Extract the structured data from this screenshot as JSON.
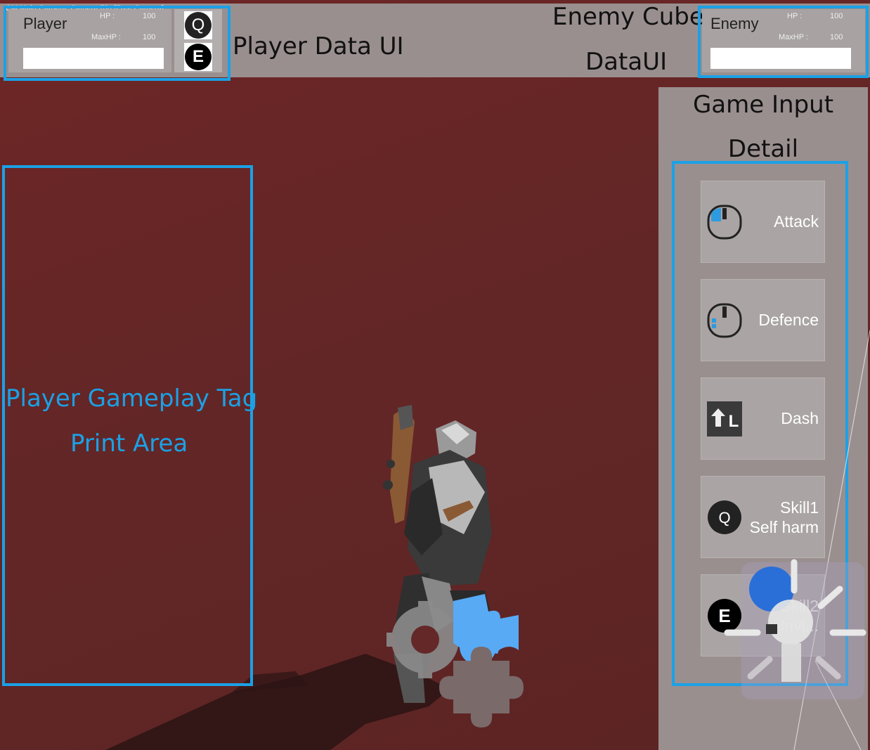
{
  "camera_caption": "CM Main Camera: Camera Rig [Free Camera]",
  "player_panel": {
    "name": "Player",
    "hp_label": "HP :",
    "hp_value": "100",
    "maxhp_label": "MaxHP :",
    "maxhp_value": "100"
  },
  "enemy_panel": {
    "name": "Enemy",
    "hp_label": "HP :",
    "hp_value": "100",
    "maxhp_label": "MaxHP :",
    "maxhp_value": "100"
  },
  "skill_icons": {
    "q_key": "Q",
    "e_key": "E"
  },
  "annotations": {
    "player_data_ui": "Player Data UI",
    "enemy_line1": "Enemy Cube",
    "enemy_line2": "DataUI",
    "game_input_line1": "Game Input",
    "game_input_line2": "Detail",
    "gameplay_tag_line1": "Player Gameplay Tag",
    "gameplay_tag_line2": "Print Area"
  },
  "input_cards": [
    {
      "label": "Attack",
      "icon": "mouse-left-click-icon"
    },
    {
      "label": "Defence",
      "icon": "mouse-right-click-icon"
    },
    {
      "label": "Dash",
      "icon": "shift-key-icon",
      "key": "L"
    },
    {
      "label_line1": "Skill1",
      "label_line2": "Self harm",
      "icon": "q-key-icon",
      "key": "Q"
    },
    {
      "label_line1": "Skill2",
      "label_line2": "Invi...",
      "icon": "e-key-icon",
      "key": "E"
    }
  ],
  "colors": {
    "annotation_blue": "#1ba1e6",
    "ground": "#6b2a2a",
    "panel": "#9a8f8f"
  }
}
